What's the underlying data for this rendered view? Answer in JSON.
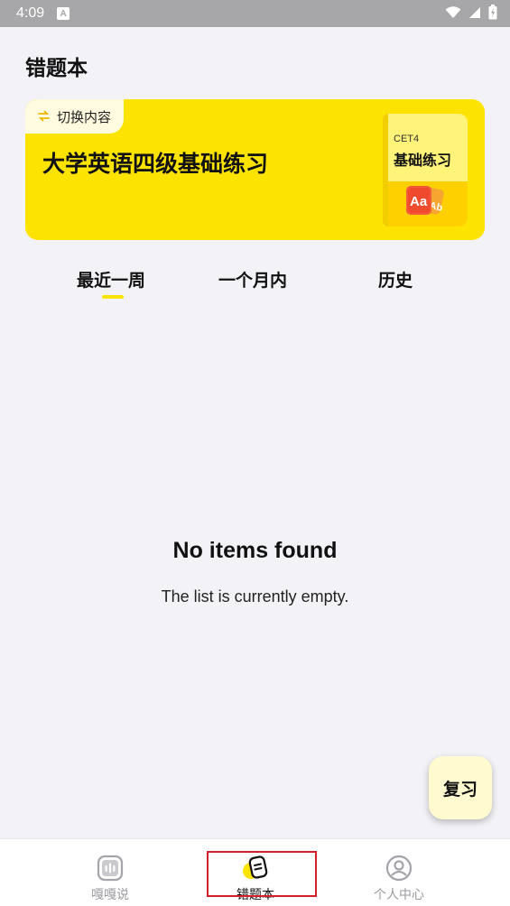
{
  "status_bar": {
    "time": "4:09",
    "notification_icon": "a-icon",
    "icons": [
      "wifi-icon",
      "signal-icon",
      "battery-icon"
    ]
  },
  "header": {
    "title": "错题本"
  },
  "banner": {
    "switch_label": "切换内容",
    "title": "大学英语四级基础练习",
    "book_tag": "CET4",
    "book_name": "基础练习",
    "book_icon_text": "Aa"
  },
  "tabs": [
    {
      "label": "最近一周",
      "active": true
    },
    {
      "label": "一个月内",
      "active": false
    },
    {
      "label": "历史",
      "active": false
    }
  ],
  "empty_state": {
    "title": "No items found",
    "subtitle": "The list is currently empty."
  },
  "fab": {
    "label": "复习"
  },
  "bottom_nav": [
    {
      "label": "嘎嘎说",
      "icon": "voice-icon",
      "active": false
    },
    {
      "label": "错题本",
      "icon": "notebook-icon",
      "active": true
    },
    {
      "label": "个人中心",
      "icon": "user-icon",
      "active": false
    }
  ],
  "colors": {
    "accent": "#fde400",
    "background": "#f3f3f7",
    "highlight": "#d4202a"
  }
}
